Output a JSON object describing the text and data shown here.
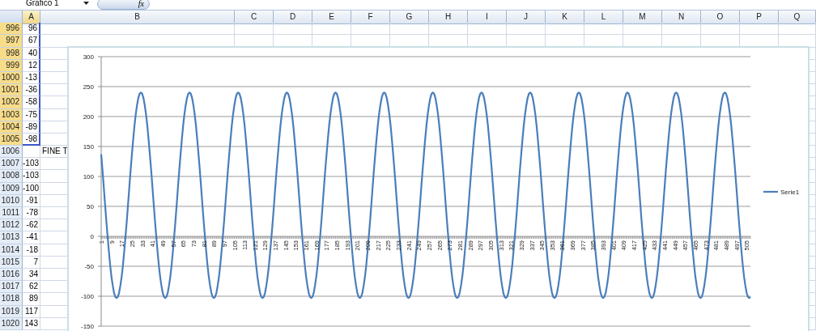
{
  "formula_bar": {
    "name_box": "Grafico 1",
    "function_label": "fx"
  },
  "columns": [
    "A",
    "B",
    "C",
    "D",
    "E",
    "F",
    "G",
    "H",
    "I",
    "J",
    "K",
    "L",
    "M",
    "N",
    "O",
    "P",
    "Q"
  ],
  "rows": [
    {
      "number": "996",
      "a": "96",
      "selected": true
    },
    {
      "number": "997",
      "a": "67",
      "selected": true
    },
    {
      "number": "998",
      "a": "40",
      "selected": true
    },
    {
      "number": "999",
      "a": "12",
      "selected": true
    },
    {
      "number": "1000",
      "a": "-13",
      "selected": true
    },
    {
      "number": "1001",
      "a": "-36",
      "selected": true
    },
    {
      "number": "1002",
      "a": "-58",
      "selected": true
    },
    {
      "number": "1003",
      "a": "-75",
      "selected": true
    },
    {
      "number": "1004",
      "a": "-89",
      "selected": true
    },
    {
      "number": "1005",
      "a": "-98",
      "selected": true
    },
    {
      "number": "1006",
      "b": "FINE T",
      "selected": false
    },
    {
      "number": "1007",
      "a": "-103",
      "selected": false
    },
    {
      "number": "1008",
      "a": "-103",
      "selected": false
    },
    {
      "number": "1009",
      "a": "-100",
      "selected": false
    },
    {
      "number": "1010",
      "a": "-91",
      "selected": false
    },
    {
      "number": "1011",
      "a": "-78",
      "selected": false
    },
    {
      "number": "1012",
      "a": "-62",
      "selected": false
    },
    {
      "number": "1013",
      "a": "-41",
      "selected": false
    },
    {
      "number": "1014",
      "a": "-18",
      "selected": false
    },
    {
      "number": "1015",
      "a": "7",
      "selected": false
    },
    {
      "number": "1016",
      "a": "34",
      "selected": false
    },
    {
      "number": "1017",
      "a": "62",
      "selected": false
    },
    {
      "number": "1018",
      "a": "89",
      "selected": false
    },
    {
      "number": "1019",
      "a": "117",
      "selected": false
    },
    {
      "number": "1020",
      "a": "143",
      "selected": false
    }
  ],
  "chart": {
    "chart_data": {
      "type": "line",
      "grid": true,
      "xlim": [
        1,
        508
      ],
      "ylim": [
        -150,
        300
      ],
      "yticks": [
        {
          "value": -150,
          "label": "-150"
        },
        {
          "value": -100,
          "label": "-100"
        },
        {
          "value": -50,
          "label": "-50"
        },
        {
          "value": 0,
          "label": "0"
        },
        {
          "value": 50,
          "label": "50"
        },
        {
          "value": 100,
          "label": "100"
        },
        {
          "value": 150,
          "label": "150"
        },
        {
          "value": 200,
          "label": "200"
        },
        {
          "value": 250,
          "label": "250"
        },
        {
          "value": 300,
          "label": "300"
        }
      ],
      "x": [
        1,
        2,
        3,
        4,
        5,
        6,
        7,
        8,
        9,
        10,
        11,
        12,
        13,
        14,
        15,
        16,
        17,
        18,
        19,
        20,
        21,
        22,
        23,
        24,
        25,
        26,
        27,
        28,
        29,
        30,
        31,
        32,
        33,
        34,
        35,
        36,
        37,
        38,
        39,
        40,
        41,
        42,
        43,
        44,
        45,
        46,
        47,
        48,
        49,
        50,
        51,
        52,
        53,
        54,
        55,
        56,
        57,
        58,
        59,
        60,
        61,
        62,
        63,
        64,
        65,
        66,
        67,
        68,
        69,
        70,
        71,
        72,
        73,
        74,
        75,
        76,
        77,
        78,
        79,
        80,
        81,
        82,
        83,
        84,
        85,
        86,
        87,
        88,
        89,
        90,
        91,
        92,
        93,
        94,
        95,
        96,
        97,
        98,
        99,
        100,
        101,
        102,
        103,
        104,
        105,
        106,
        107,
        108,
        109,
        110,
        111,
        112,
        113,
        114,
        115,
        116,
        117,
        118,
        119,
        120,
        121,
        122,
        123,
        124,
        125,
        126,
        127,
        128,
        129,
        130,
        131,
        132,
        133,
        134,
        135,
        136,
        137,
        138,
        139,
        140,
        141,
        142,
        143,
        144,
        145,
        146,
        147,
        148,
        149,
        150,
        151,
        152,
        153,
        154,
        155,
        156,
        157,
        158,
        159,
        160,
        161,
        162,
        163,
        164,
        165,
        166,
        167,
        168,
        169,
        170,
        171,
        172,
        173,
        174,
        175,
        176,
        177,
        178,
        179,
        180,
        181,
        182,
        183,
        184,
        185,
        186,
        187,
        188,
        189,
        190,
        191,
        192,
        193,
        194,
        195,
        196,
        197,
        198,
        199,
        200,
        201,
        202,
        203,
        204,
        205,
        206,
        207,
        208,
        209,
        210,
        211,
        212,
        213,
        214,
        215,
        216,
        217,
        218,
        219,
        220,
        221,
        222,
        223,
        224,
        225,
        226,
        227,
        228,
        229,
        230,
        231,
        232,
        233,
        234,
        235,
        236,
        237,
        238,
        239,
        240,
        241,
        242,
        243,
        244,
        245,
        246,
        247,
        248,
        249,
        250,
        251,
        252,
        253,
        254,
        255,
        256,
        257,
        258,
        259,
        260,
        261,
        262,
        263,
        264,
        265,
        266,
        267,
        268,
        269,
        270,
        271,
        272,
        273,
        274,
        275,
        276,
        277,
        278,
        279,
        280,
        281,
        282,
        283,
        284,
        285,
        286,
        287,
        288,
        289,
        290,
        291,
        292,
        293,
        294,
        295,
        296,
        297,
        298,
        299,
        300,
        301,
        302,
        303,
        304,
        305,
        306,
        307,
        308,
        309,
        310,
        311,
        312,
        313,
        314,
        315,
        316,
        317,
        318,
        319,
        320,
        321,
        322,
        323,
        324,
        325,
        326,
        327,
        328,
        329,
        330,
        331,
        332,
        333,
        334,
        335,
        336,
        337,
        338,
        339,
        340,
        341,
        342,
        343,
        344,
        345,
        346,
        347,
        348,
        349,
        350,
        351,
        352,
        353,
        354,
        355,
        356,
        357,
        358,
        359,
        360,
        361,
        362,
        363,
        364,
        365,
        366,
        367,
        368,
        369,
        370,
        371,
        372,
        373,
        374,
        375,
        376,
        377,
        378,
        379,
        380,
        381,
        382,
        383,
        384,
        385,
        386,
        387,
        388,
        389,
        390,
        391,
        392,
        393,
        394,
        395,
        396,
        397,
        398,
        399,
        400,
        401,
        402,
        403,
        404,
        405,
        406,
        407,
        408,
        409,
        410,
        411,
        412,
        413,
        414,
        415,
        416,
        417,
        418,
        419,
        420,
        421,
        422,
        423,
        424,
        425,
        426,
        427,
        428,
        429,
        430,
        431,
        432,
        433,
        434,
        435,
        436,
        437,
        438,
        439,
        440,
        441,
        442,
        443,
        444,
        445,
        446,
        447,
        448,
        449,
        450,
        451,
        452,
        453,
        454,
        455,
        456,
        457,
        458,
        459,
        460,
        461,
        462,
        463,
        464,
        465,
        466,
        467,
        468,
        469,
        470,
        471,
        472,
        473,
        474,
        475,
        476,
        477,
        478,
        479,
        480,
        481,
        482,
        483,
        484,
        485,
        486,
        487,
        488,
        489,
        490,
        491,
        492,
        493,
        494,
        495,
        496,
        497,
        498,
        499,
        500,
        501,
        502,
        503,
        504,
        505,
        506,
        507,
        508
      ],
      "xticks": [
        1,
        9,
        17,
        25,
        33,
        41,
        49,
        57,
        65,
        73,
        81,
        {
          "value": 89,
          "label": "89"
        },
        97,
        105,
        113,
        121,
        129,
        137,
        145,
        153,
        161,
        169,
        177,
        185,
        193,
        201,
        209,
        217,
        225,
        233,
        241,
        249,
        257,
        265,
        273,
        281,
        289,
        297,
        305,
        313,
        321,
        329,
        337,
        345,
        353,
        361,
        369,
        377,
        385,
        393,
        401,
        409,
        417,
        425,
        433,
        441,
        449,
        457,
        465,
        473,
        481,
        489,
        497,
        505
      ],
      "series": [
        {
          "name": "Serie1",
          "color": "#4a7ebb",
          "values": [
            137,
            111,
            83,
            54,
            26,
            0,
            -25,
            -48,
            -67,
            -82,
            -94,
            -101,
            -103,
            -101,
            -94,
            -82,
            -67,
            -48,
            -25,
            0,
            26,
            54,
            83,
            111,
            137,
            162,
            185,
            204,
            219,
            231,
            238,
            240,
            238,
            231,
            219,
            204,
            185,
            162,
            137,
            111,
            83,
            54,
            26,
            0,
            -25,
            -48,
            -67,
            -82,
            -94,
            -101,
            -103,
            -101,
            -94,
            -82,
            -67,
            -48,
            -25,
            0,
            26,
            54,
            83,
            111,
            137,
            162,
            185,
            204,
            219,
            231,
            238,
            240,
            238,
            231,
            219,
            204,
            185,
            162,
            137,
            111,
            83,
            54,
            26,
            0,
            -25,
            -48,
            -67,
            -82,
            -94,
            -101,
            -103,
            -101,
            -94,
            -82,
            -67,
            -48,
            -25,
            0,
            26,
            54,
            83,
            111,
            137,
            162,
            185,
            204,
            219,
            231,
            238,
            240,
            238,
            231,
            219,
            204,
            185,
            162,
            137,
            111,
            83,
            54,
            26,
            0,
            -25,
            -48,
            -67,
            -82,
            -94,
            -101,
            -103,
            -101,
            -94,
            -82,
            -67,
            -48,
            -25,
            0,
            26,
            54,
            83,
            111,
            137,
            162,
            185,
            204,
            219,
            231,
            238,
            240,
            238,
            231,
            219,
            204,
            185,
            162,
            137,
            111,
            83,
            54,
            26,
            0,
            -25,
            -48,
            -67,
            -82,
            -94,
            -101,
            -103,
            -101,
            -94,
            -82,
            -67,
            -48,
            -25,
            0,
            26,
            54,
            83,
            111,
            137,
            162,
            185,
            204,
            219,
            231,
            238,
            240,
            238,
            231,
            219,
            204,
            185,
            162,
            137,
            111,
            83,
            54,
            26,
            0,
            -25,
            -48,
            -67,
            -82,
            -94,
            -101,
            -103,
            -101,
            -94,
            -82,
            -67,
            -48,
            -25,
            0,
            26,
            54,
            83,
            111,
            137,
            162,
            185,
            204,
            219,
            231,
            238,
            240,
            238,
            231,
            219,
            204,
            185,
            162,
            137,
            111,
            83,
            54,
            26,
            0,
            -25,
            -48,
            -67,
            -82,
            -94,
            -101,
            -103,
            -101,
            -94,
            -82,
            -67,
            -48,
            -25,
            0,
            26,
            54,
            83,
            111,
            137,
            162,
            185,
            204,
            219,
            231,
            238,
            240,
            238,
            231,
            219,
            204,
            185,
            162,
            137,
            111,
            83,
            54,
            26,
            0,
            -25,
            -48,
            -67,
            -82,
            -94,
            -101,
            -103,
            -101,
            -94,
            -82,
            -67,
            -48,
            -25,
            0,
            26,
            54,
            83,
            111,
            137,
            162,
            185,
            204,
            219,
            231,
            238,
            240,
            238,
            231,
            219,
            204,
            185,
            162,
            137,
            111,
            83,
            54,
            26,
            0,
            -25,
            -48,
            -67,
            -82,
            -94,
            -101,
            -103,
            -101,
            -94,
            -82,
            -67,
            -48,
            -25,
            0,
            26,
            54,
            83,
            111,
            137,
            162,
            185,
            204,
            219,
            231,
            238,
            240,
            238,
            231,
            219,
            204,
            185,
            162,
            137,
            111,
            83,
            54,
            26,
            0,
            -25,
            -48,
            -67,
            -82,
            -94,
            -101,
            -103,
            -101,
            -94,
            -82,
            -67,
            -48,
            -25,
            0,
            26,
            54,
            83,
            111,
            137,
            162,
            185,
            204,
            219,
            231,
            238,
            240,
            238,
            231,
            219,
            204,
            185,
            162,
            137,
            111,
            83,
            54,
            26,
            0,
            -25,
            -48,
            -67,
            -82,
            -94,
            -101,
            -103,
            -101,
            -94,
            -82,
            -67,
            -48,
            -25,
            0,
            26,
            54,
            83,
            111,
            137,
            162,
            185,
            204,
            219,
            231,
            238,
            240,
            238,
            231,
            219,
            204,
            185,
            162,
            137,
            111,
            83,
            54,
            26,
            0,
            -25,
            -48,
            -67,
            -82,
            -94,
            -101,
            -103,
            -101,
            -94,
            -82,
            -67,
            -48,
            -25,
            0,
            26,
            54,
            83,
            111,
            137,
            162,
            185,
            204,
            219,
            231,
            238,
            240,
            238,
            231,
            219,
            204,
            185,
            162,
            137,
            111,
            83,
            54,
            26,
            0,
            -25,
            -48,
            -67,
            -82,
            -94,
            -101,
            -103,
            -101,
            -94,
            -82,
            -67,
            -48,
            -25,
            0,
            26,
            54,
            83,
            111,
            137,
            162,
            185,
            204,
            219,
            231,
            238,
            240,
            238,
            231,
            219,
            204,
            185,
            162,
            137,
            111,
            83,
            54,
            26,
            0,
            -25,
            -48,
            -67,
            -82,
            -94,
            -101,
            -103,
            -101
          ]
        }
      ]
    }
  }
}
